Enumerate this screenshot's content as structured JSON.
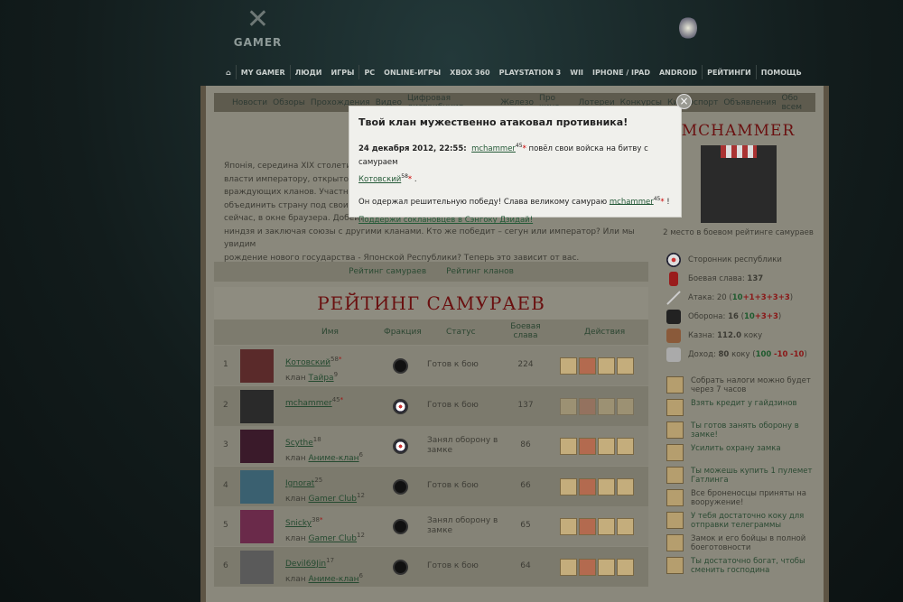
{
  "logo": {
    "text": "GAMER"
  },
  "topnav": [
    "MY GAMER",
    "ЛЮДИ",
    "ИГРЫ",
    "PC",
    "ONLINE-ИГРЫ",
    "XBOX 360",
    "PLAYSTATION 3",
    "WII",
    "IPHONE / IPAD",
    "ANDROID",
    "РЕЙТИНГИ",
    "ПОМОЩЬ"
  ],
  "subnav": [
    "Новости",
    "Обзоры",
    "Прохождения",
    "Видео",
    "Цифровая дистрибуция",
    "Железо",
    "Про кино",
    "Лотереи",
    "Конкурсы",
    "Киберспорт",
    "Объявления",
    "Обо всем"
  ],
  "intro": [
    "Японія, середина XIX столетия.",
    "власти императору, открыто выс",
    "враждующих кланов. Участники",
    "объединить страну под своим на",
    "сейчас, в окне браузера. Добейт",
    "ниндзя и заключая союзы с другими кланами. Кто же победит – сегун или император? Или мы увидим",
    "рождение нового государства - Японской Республики? Теперь это зависит от вас."
  ],
  "tabs": [
    "Рейтинг самураев",
    "Рейтинг кланов"
  ],
  "rating_title": "РЕЙТИНГ САМУРАЕВ",
  "columns": {
    "name": "Имя",
    "faction": "Фракция",
    "status": "Статус",
    "glory": "Боевая слава",
    "actions": "Действия"
  },
  "clan_prefix": "клан",
  "rows": [
    {
      "n": "1",
      "name": "Котовский",
      "lvl": "58",
      "star": "*",
      "clan": "Тайра",
      "clan_lvl": "9",
      "faction": "shogun",
      "status": "Готов к бою",
      "glory": "224",
      "av": "#5a2a2a"
    },
    {
      "n": "2",
      "name": "mchammer",
      "lvl": "45",
      "star": "*",
      "clan": "",
      "clan_lvl": "",
      "faction": "republic",
      "status": "Готов к бою",
      "glory": "137",
      "av": "#2a2a2a"
    },
    {
      "n": "3",
      "name": "Scythe",
      "lvl": "18",
      "star": "",
      "clan": "Аниме-клан",
      "clan_lvl": "6",
      "faction": "republic",
      "status": "Занял оборону в замке",
      "glory": "86",
      "av": "#3a1a2a"
    },
    {
      "n": "4",
      "name": "Ignorat",
      "lvl": "25",
      "star": "",
      "clan": "Gamer Club",
      "clan_lvl": "12",
      "faction": "shogun",
      "status": "Готов к бою",
      "glory": "66",
      "av": "#3a6070"
    },
    {
      "n": "5",
      "name": "Snicky",
      "lvl": "38",
      "star": "*",
      "clan": "Gamer Club",
      "clan_lvl": "12",
      "faction": "shogun",
      "status": "Занял оборону в замке",
      "glory": "65",
      "av": "#6a2a4a"
    },
    {
      "n": "6",
      "name": "Devil69Jin",
      "lvl": "17",
      "star": "",
      "clan": "Аниме-клан",
      "clan_lvl": "6",
      "faction": "shogun",
      "status": "Готов к бою",
      "glory": "64",
      "av": "#5a5a5a"
    }
  ],
  "profile": {
    "name": "MCHAMMER",
    "place": "2 место в боевом рейтинге самураев",
    "faction": "Сторонник республики",
    "glory_label": "Боевая слава:",
    "glory": "137",
    "attack_label": "Атака: 20 (",
    "attack_parts": [
      "10",
      "+1",
      "+3",
      "+3",
      "+3"
    ],
    "defense_label": "Оборона:",
    "defense": "16",
    "defense_parts": [
      "10",
      "+3",
      "+3"
    ],
    "treasury_label": "Казна:",
    "treasury": "112.0",
    "treasury_unit": "коку",
    "income_label": "Доход:",
    "income": "80",
    "income_unit": "коку",
    "income_parts": [
      "100",
      "-10",
      "-10"
    ]
  },
  "actions": [
    "Собрать налоги можно будет через 7 часов",
    "Взять кредит у гайдзинов",
    "Ты готов занять оборону в замке!",
    "Усилить охрану замка",
    "Ты можешь купить 1 пулемет Гатлинга",
    "Все броненосцы приняты на вооружение!",
    "У тебя достаточно коку для отправки телеграммы",
    "Замок и его бойцы в полной боеготовности",
    "Ты достаточно богат, чтобы сменить господина"
  ],
  "modal": {
    "title": "Твой клан мужественно атаковал противника!",
    "date": "24 декабря 2012, 22:55:",
    "attacker": "mchammer",
    "attacker_lvl": "45",
    "text1": "повёл свои войска на битву с самураем",
    "defender": "Котовский",
    "defender_lvl": "58",
    "text2": "Он одержал решительную победу! Слава великому самураю",
    "winner": "mchammer",
    "winner_lvl": "45",
    "link": "Поддержи соклановцев в Сэнгоку Дзидай!",
    "close": "×"
  }
}
